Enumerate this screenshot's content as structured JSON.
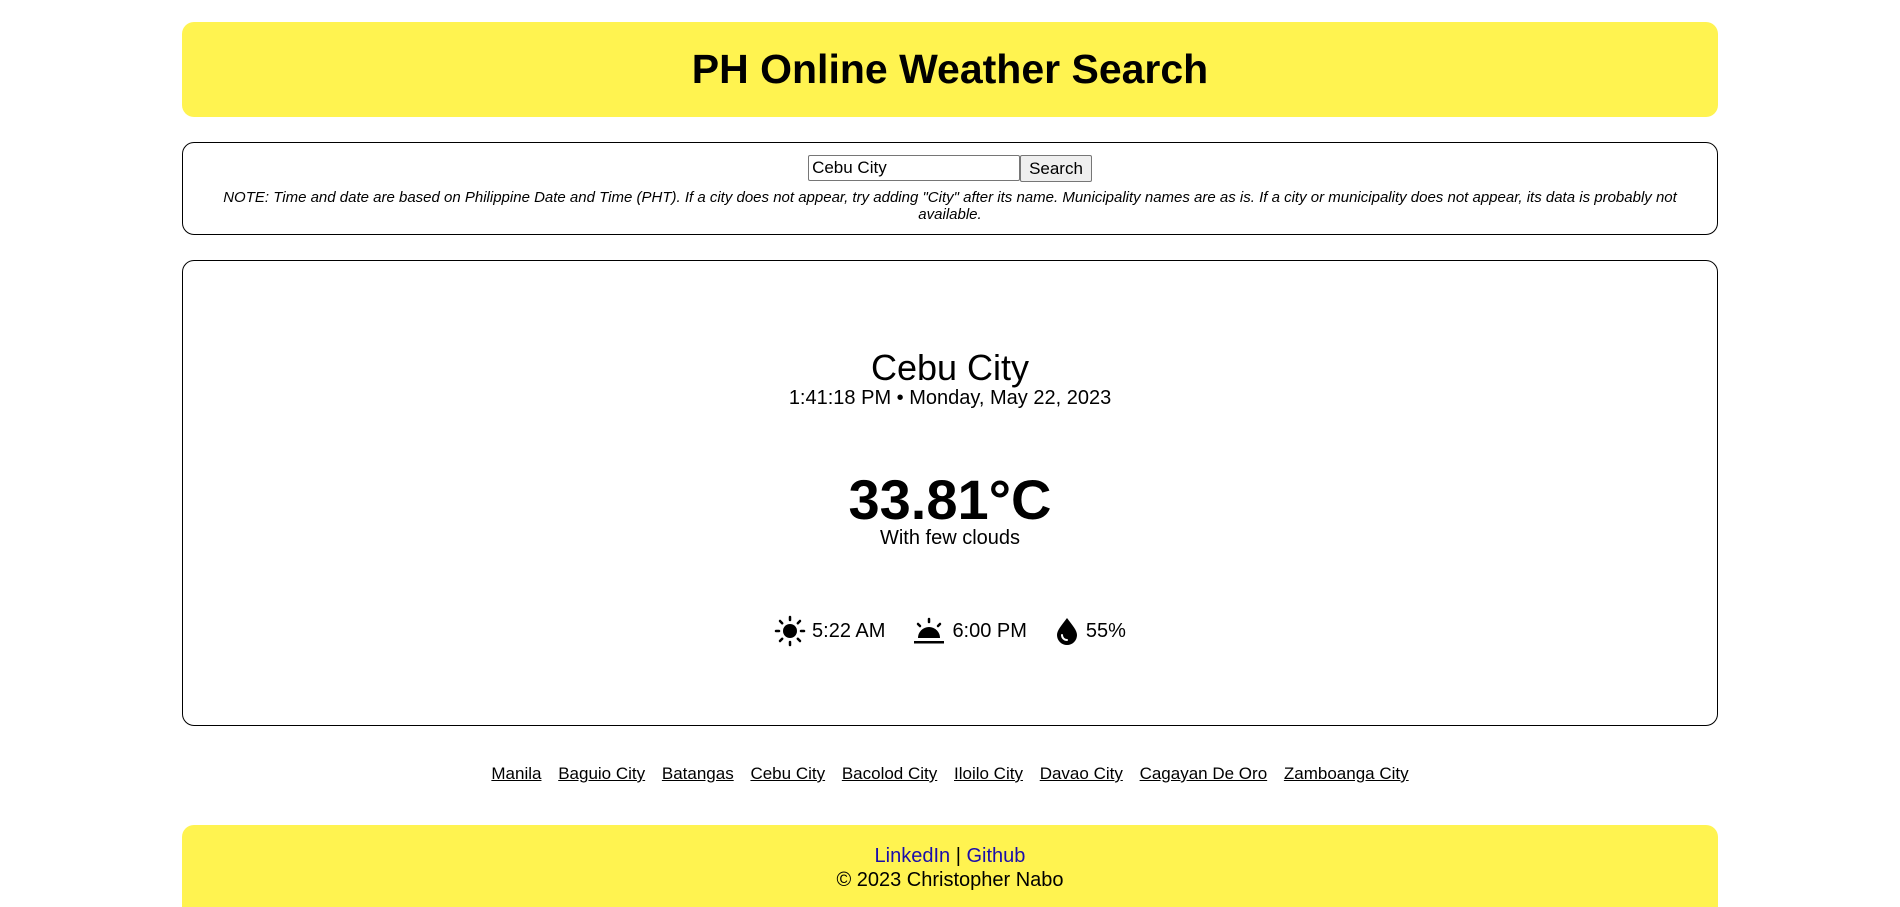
{
  "header": {
    "title": "PH Online Weather Search"
  },
  "search": {
    "value": "Cebu City",
    "button_label": "Search",
    "note": "NOTE: Time and date are based on Philippine Date and Time (PHT). If a city does not appear, try adding \"City\" after its name. Municipality names are as is. If a city or municipality does not appear, its data is probably not available."
  },
  "weather": {
    "city": "Cebu City",
    "datetime": "1:41:18 PM • Monday, May 22, 2023",
    "temperature": "33.81°C",
    "description": "With few clouds",
    "sunrise": "5:22 AM",
    "sunset": "6:00 PM",
    "humidity": "55%",
    "icons": [
      "sun-icon",
      "sunset-icon",
      "droplet-icon"
    ]
  },
  "cities": [
    "Manila",
    "Baguio City",
    "Batangas",
    "Cebu City",
    "Bacolod City",
    "Iloilo City",
    "Davao City",
    "Cagayan De Oro",
    "Zamboanga City"
  ],
  "footer": {
    "linkedin_label": "LinkedIn",
    "separator": "|",
    "github_label": "Github",
    "copyright": "© 2023 Christopher Nabo"
  },
  "colors": {
    "accent": "#fff350",
    "link": "#1a0dab"
  }
}
